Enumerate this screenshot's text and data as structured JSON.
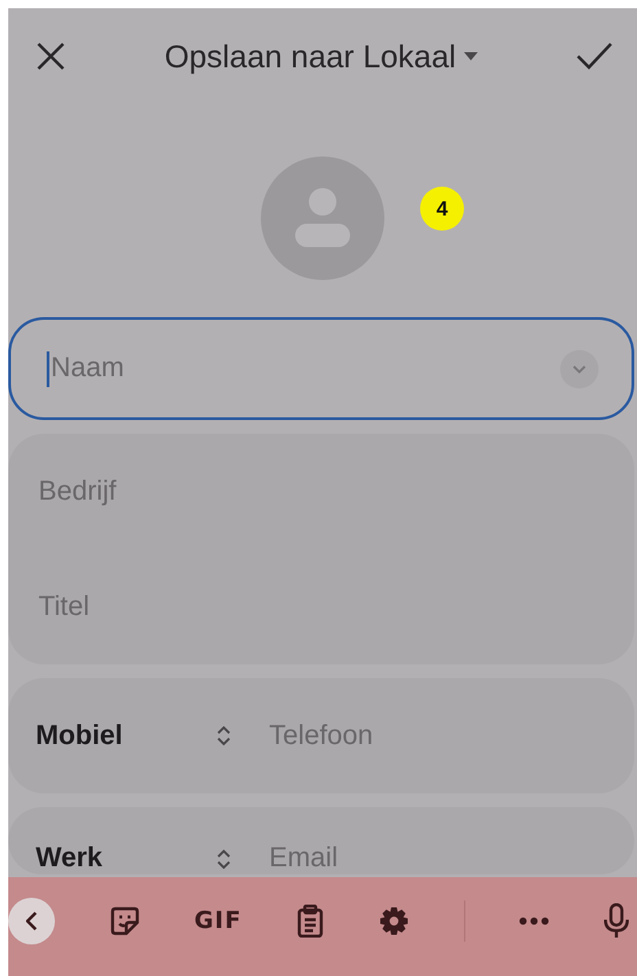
{
  "header": {
    "title": "Opslaan naar Lokaal"
  },
  "avatar": {
    "badge": "4"
  },
  "name_field": {
    "placeholder": "Naam",
    "focused": true
  },
  "organization": [
    {
      "placeholder": "Bedrijf"
    },
    {
      "placeholder": "Titel"
    }
  ],
  "typed_rows": [
    {
      "label": "Mobiel",
      "placeholder": "Telefoon"
    },
    {
      "label": "Werk",
      "placeholder": "Email"
    }
  ],
  "keyboard_toolbar": [
    {
      "kind": "back"
    },
    {
      "kind": "sticker"
    },
    {
      "kind": "text",
      "label": "GIF"
    },
    {
      "kind": "clipboard"
    },
    {
      "kind": "settings"
    },
    {
      "kind": "divider"
    },
    {
      "kind": "more"
    },
    {
      "kind": "mic"
    }
  ]
}
